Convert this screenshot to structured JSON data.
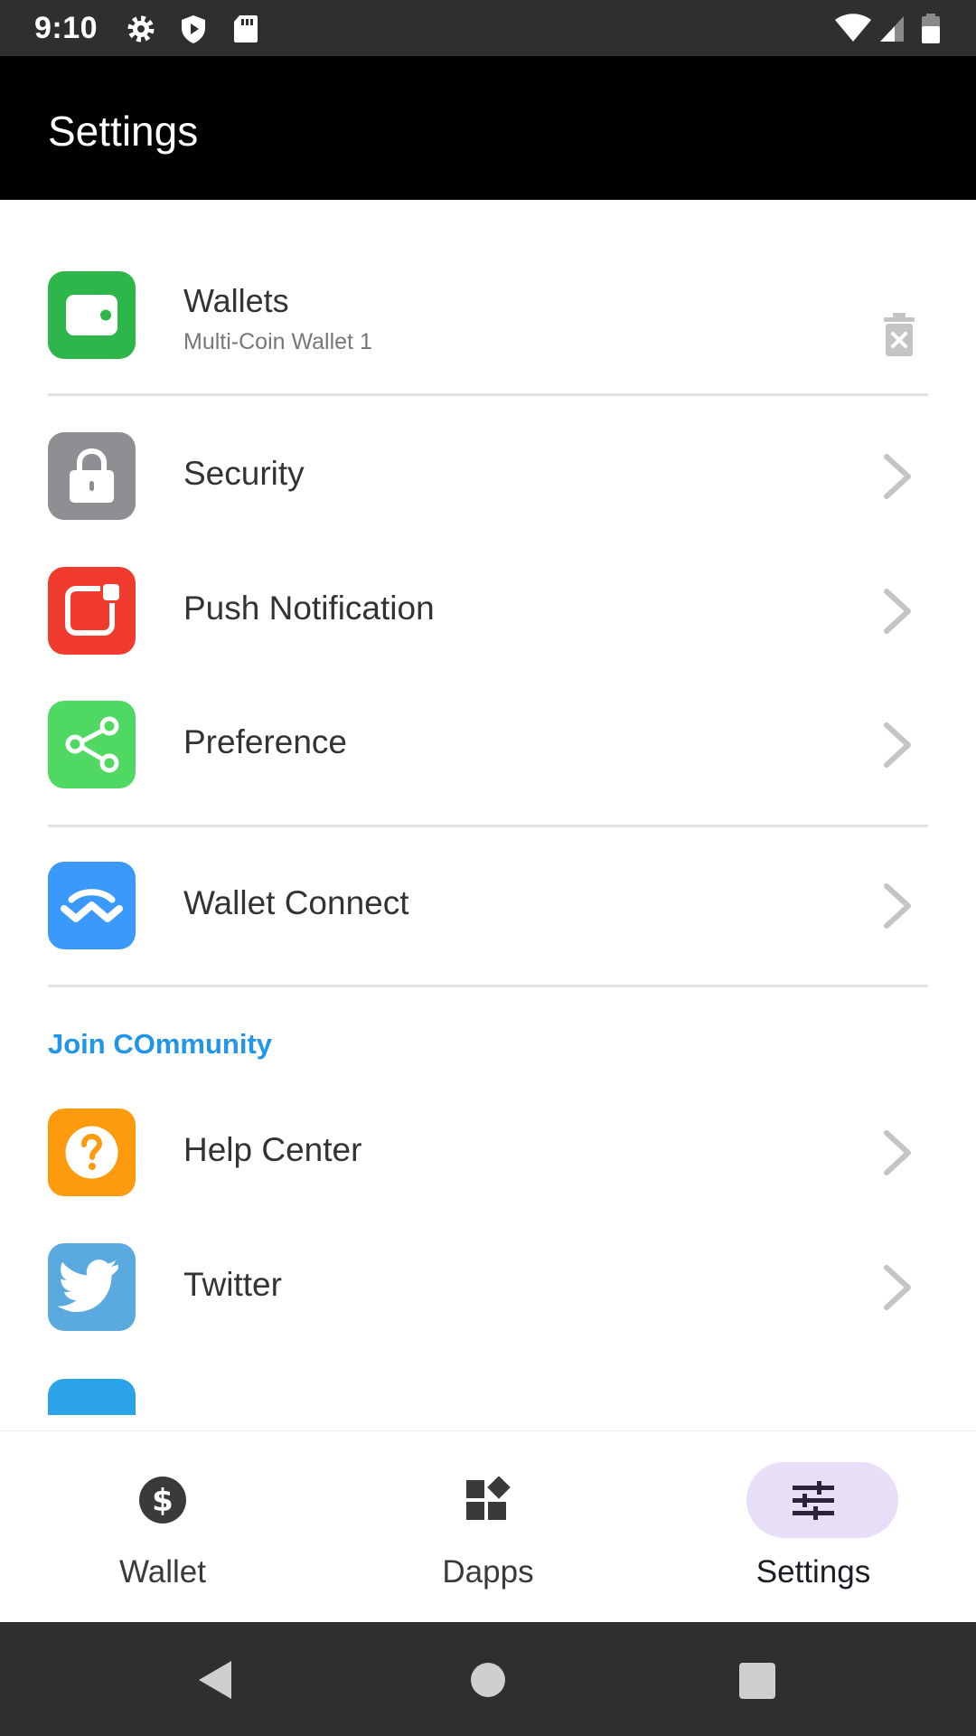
{
  "status_bar": {
    "time": "9:10",
    "left_icons": [
      "gear-icon",
      "shield-play-icon",
      "sd-card-icon"
    ],
    "right_icons": [
      "wifi-icon",
      "cellular-signal-icon",
      "battery-icon"
    ]
  },
  "app_bar": {
    "title": "Settings"
  },
  "settings": {
    "wallets": {
      "label": "Wallets",
      "subtitle": "Multi-Coin Wallet 1",
      "icon": "wallet-icon",
      "icon_color": "#2fb64a",
      "action_icon": "delete-icon"
    },
    "items": [
      {
        "label": "Security",
        "icon": "lock-icon",
        "icon_color": "#8e8e93"
      },
      {
        "label": "Push Notification",
        "icon": "notification-icon",
        "icon_color": "#f23b2f"
      },
      {
        "label": "Preference",
        "icon": "share-icon",
        "icon_color": "#4fd963"
      },
      {
        "label": "Wallet Connect",
        "icon": "walletconnect-icon",
        "icon_color": "#3b99fc"
      }
    ],
    "community": {
      "title": "Join COmmunity",
      "items": [
        {
          "label": "Help Center",
          "icon": "help-icon",
          "icon_color": "#fd9a0d"
        },
        {
          "label": "Twitter",
          "icon": "twitter-icon",
          "icon_color": "#5aa9df"
        }
      ]
    }
  },
  "bottom_nav": {
    "items": [
      {
        "label": "Wallet",
        "icon": "dollar-icon",
        "active": false
      },
      {
        "label": "Dapps",
        "icon": "dapps-icon",
        "active": false
      },
      {
        "label": "Settings",
        "icon": "sliders-icon",
        "active": true
      }
    ],
    "active_pill_color": "#e8def8"
  },
  "system_nav": {
    "buttons": [
      "back-icon",
      "home-icon",
      "recents-icon"
    ]
  }
}
